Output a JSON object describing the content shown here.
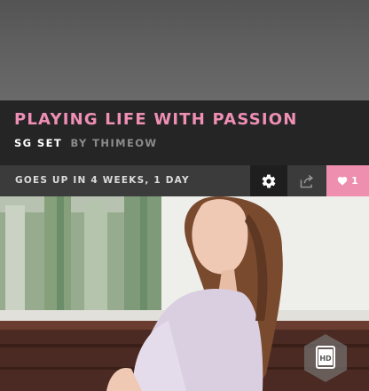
{
  "set": {
    "title": "PLAYING LIFE WITH PASSION",
    "type": "SG SET",
    "byline": "BY THIMEOW"
  },
  "actions": {
    "release": "GOES UP IN 4 WEEKS, 1 DAY",
    "settings_icon": "gear-icon",
    "share_icon": "share-icon",
    "like_icon": "heart-icon",
    "like_count": "1"
  },
  "badge": {
    "label": "HD"
  },
  "colors": {
    "accent": "#ee8fb0",
    "title_pink": "#ef8fb3",
    "header_bg": "#252526",
    "bar_bg": "#3b3b3c"
  }
}
